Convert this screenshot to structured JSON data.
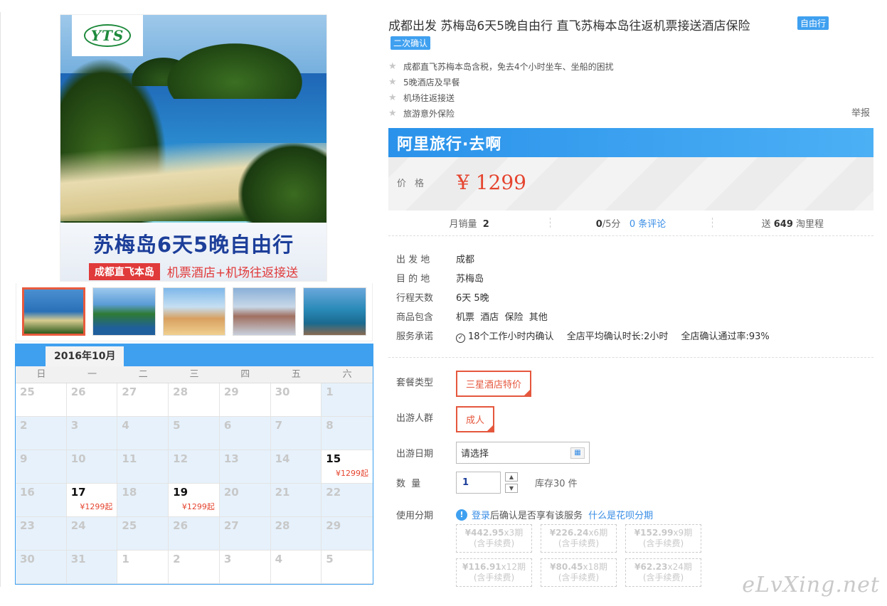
{
  "gallery": {
    "logo_text": "YTS",
    "banner_title": "苏梅岛6天5晚自由行",
    "banner_tag": "成都直飞本岛",
    "banner_text": "机票酒店+机场往返接送",
    "thumbnails": [
      "thumb-1",
      "thumb-2",
      "thumb-3",
      "thumb-4",
      "thumb-5"
    ],
    "selected_index": 0
  },
  "calendar": {
    "month": "2016年10月",
    "weekdays": [
      "日",
      "一",
      "二",
      "三",
      "四",
      "五",
      "六"
    ],
    "cells": [
      {
        "day": "25"
      },
      {
        "day": "26"
      },
      {
        "day": "27"
      },
      {
        "day": "28"
      },
      {
        "day": "29"
      },
      {
        "day": "30"
      },
      {
        "day": "1"
      },
      {
        "day": "2"
      },
      {
        "day": "3"
      },
      {
        "day": "4"
      },
      {
        "day": "5"
      },
      {
        "day": "6"
      },
      {
        "day": "7"
      },
      {
        "day": "8"
      },
      {
        "day": "9"
      },
      {
        "day": "10"
      },
      {
        "day": "11"
      },
      {
        "day": "12"
      },
      {
        "day": "13"
      },
      {
        "day": "14"
      },
      {
        "day": "15",
        "price": "¥1299起"
      },
      {
        "day": "16"
      },
      {
        "day": "17",
        "price": "¥1299起"
      },
      {
        "day": "18"
      },
      {
        "day": "19",
        "price": "¥1299起"
      },
      {
        "day": "20"
      },
      {
        "day": "21"
      },
      {
        "day": "22"
      },
      {
        "day": "23"
      },
      {
        "day": "24"
      },
      {
        "day": "25"
      },
      {
        "day": "26"
      },
      {
        "day": "27"
      },
      {
        "day": "28"
      },
      {
        "day": "29"
      },
      {
        "day": "30"
      },
      {
        "day": "31"
      },
      {
        "day": "1"
      },
      {
        "day": "2"
      },
      {
        "day": "3"
      },
      {
        "day": "4"
      },
      {
        "day": "5"
      }
    ]
  },
  "product": {
    "title": "成都出发 苏梅岛6天5晚自由行 直飞苏梅本岛往返机票接送酒店保险",
    "title_tag": "自由行",
    "confirm_tag": "二次确认",
    "features": [
      "成都直飞苏梅本岛含税，免去4个小时坐车、坐船的困扰",
      "5晚酒店及早餐",
      "机场往返接送",
      "旅游意外保险"
    ],
    "report": "举报"
  },
  "price_box": {
    "brand": "阿里旅行·去啊",
    "label": "价格",
    "value": "¥ 1299"
  },
  "stats": {
    "sales_label": "月销量",
    "sales_value": "2",
    "rating_value": "0",
    "rating_suffix": "/5分",
    "reviews": "0 条评论",
    "points_prefix": "送",
    "points_value": "649",
    "points_suffix": "淘里程"
  },
  "info": {
    "rows": [
      {
        "label": "出 发 地",
        "value": "成都"
      },
      {
        "label": "目 的 地",
        "value": "苏梅岛"
      },
      {
        "label": "行程天数",
        "value": "6天 5晚"
      },
      {
        "label": "商品包含",
        "value": "机票  酒店  保险  其他"
      }
    ],
    "service_label": "服务承诺",
    "service_items": [
      "18个工作小时内确认",
      "全店平均确认时长:2小时",
      "全店确认通过率:93%"
    ]
  },
  "options": {
    "package_label": "套餐类型",
    "package_value": "三星酒店特价",
    "traveler_label": "出游人群",
    "traveler_value": "成人",
    "date_label": "出游日期",
    "date_value": "请选择",
    "qty_label": "数  量",
    "qty_value": "1",
    "stock": "库存30 件",
    "install_label": "使用分期",
    "install_login": "登录",
    "install_note": "后确认是否享有该服务",
    "install_link": "什么是花呗分期",
    "installments": [
      {
        "amount": "¥442.95",
        "periods": "x3期",
        "fee": "(含手续费)"
      },
      {
        "amount": "¥226.24",
        "periods": "x6期",
        "fee": "(含手续费)"
      },
      {
        "amount": "¥152.99",
        "periods": "x9期",
        "fee": "(含手续费)"
      },
      {
        "amount": "¥116.91",
        "periods": "x12期",
        "fee": "(含手续费)"
      },
      {
        "amount": "¥80.45",
        "periods": "x18期",
        "fee": "(含手续费)"
      },
      {
        "amount": "¥62.23",
        "periods": "x24期",
        "fee": "(含手续费)"
      }
    ]
  },
  "watermark": "eLvXing.net",
  "colors": {
    "accent_blue": "#3fa0f0",
    "price_red": "#e5452f",
    "chip_red": "#e5573d"
  }
}
